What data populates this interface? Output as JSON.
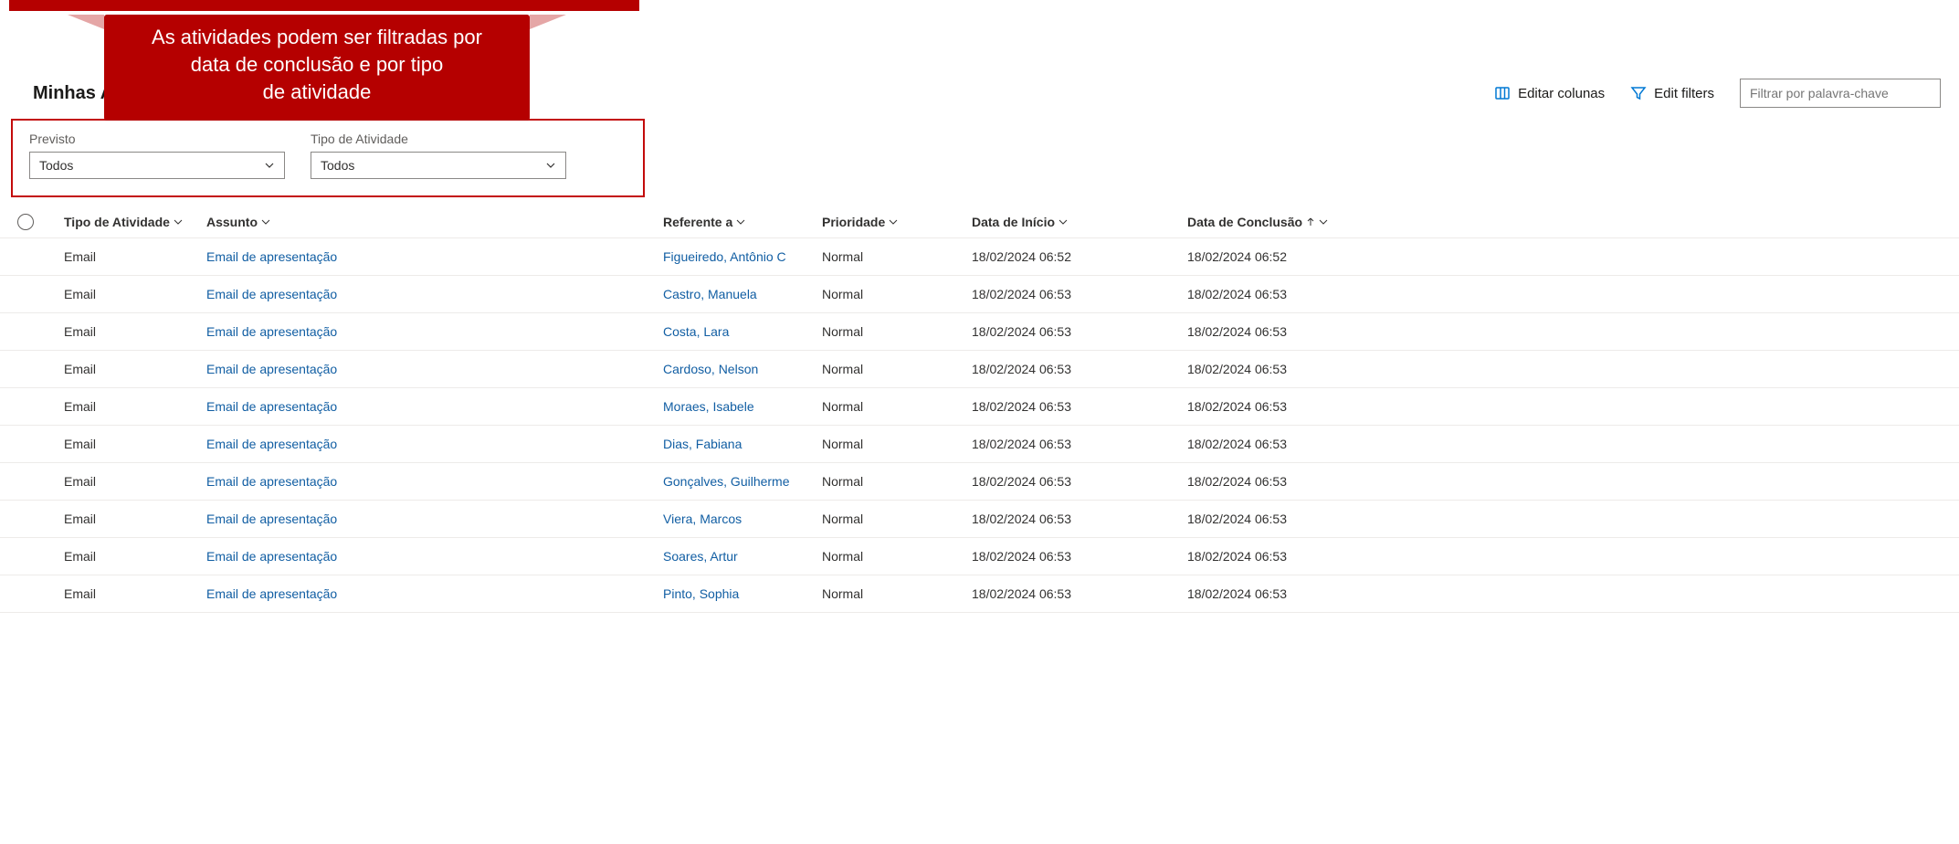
{
  "callout": {
    "line1": "As atividades podem ser filtradas por",
    "line2": "data de conclusão e por tipo",
    "line3": "de atividade"
  },
  "header": {
    "page_title": "Minhas A",
    "edit_columns": "Editar colunas",
    "edit_filters": "Edit filters",
    "search_placeholder": "Filtrar por palavra-chave"
  },
  "filters": {
    "previsto_label": "Previsto",
    "previsto_value": "Todos",
    "tipo_label": "Tipo de Atividade",
    "tipo_value": "Todos"
  },
  "columns": {
    "tipo": "Tipo de Atividade",
    "assunto": "Assunto",
    "referente": "Referente a",
    "prioridade": "Prioridade",
    "inicio": "Data de Início",
    "conclusao": "Data de Conclusão"
  },
  "rows": [
    {
      "tipo": "Email",
      "assunto": "Email de apresentação",
      "referente": "Figueiredo, Antônio C",
      "prioridade": "Normal",
      "inicio": "18/02/2024 06:52",
      "conclusao": "18/02/2024 06:52"
    },
    {
      "tipo": "Email",
      "assunto": "Email de apresentação",
      "referente": "Castro, Manuela",
      "prioridade": "Normal",
      "inicio": "18/02/2024 06:53",
      "conclusao": "18/02/2024 06:53"
    },
    {
      "tipo": "Email",
      "assunto": "Email de apresentação",
      "referente": "Costa, Lara",
      "prioridade": "Normal",
      "inicio": "18/02/2024 06:53",
      "conclusao": "18/02/2024 06:53"
    },
    {
      "tipo": "Email",
      "assunto": "Email de apresentação",
      "referente": "Cardoso, Nelson",
      "prioridade": "Normal",
      "inicio": "18/02/2024 06:53",
      "conclusao": "18/02/2024 06:53"
    },
    {
      "tipo": "Email",
      "assunto": "Email de apresentação",
      "referente": "Moraes, Isabele",
      "prioridade": "Normal",
      "inicio": "18/02/2024 06:53",
      "conclusao": "18/02/2024 06:53"
    },
    {
      "tipo": "Email",
      "assunto": "Email de apresentação",
      "referente": "Dias, Fabiana",
      "prioridade": "Normal",
      "inicio": "18/02/2024 06:53",
      "conclusao": "18/02/2024 06:53"
    },
    {
      "tipo": "Email",
      "assunto": "Email de apresentação",
      "referente": "Gonçalves, Guilherme",
      "prioridade": "Normal",
      "inicio": "18/02/2024 06:53",
      "conclusao": "18/02/2024 06:53"
    },
    {
      "tipo": "Email",
      "assunto": "Email de apresentação",
      "referente": "Viera, Marcos",
      "prioridade": "Normal",
      "inicio": "18/02/2024 06:53",
      "conclusao": "18/02/2024 06:53"
    },
    {
      "tipo": "Email",
      "assunto": "Email de apresentação",
      "referente": "Soares, Artur",
      "prioridade": "Normal",
      "inicio": "18/02/2024 06:53",
      "conclusao": "18/02/2024 06:53"
    },
    {
      "tipo": "Email",
      "assunto": "Email de apresentação",
      "referente": "Pinto, Sophia",
      "prioridade": "Normal",
      "inicio": "18/02/2024 06:53",
      "conclusao": "18/02/2024 06:53"
    }
  ]
}
